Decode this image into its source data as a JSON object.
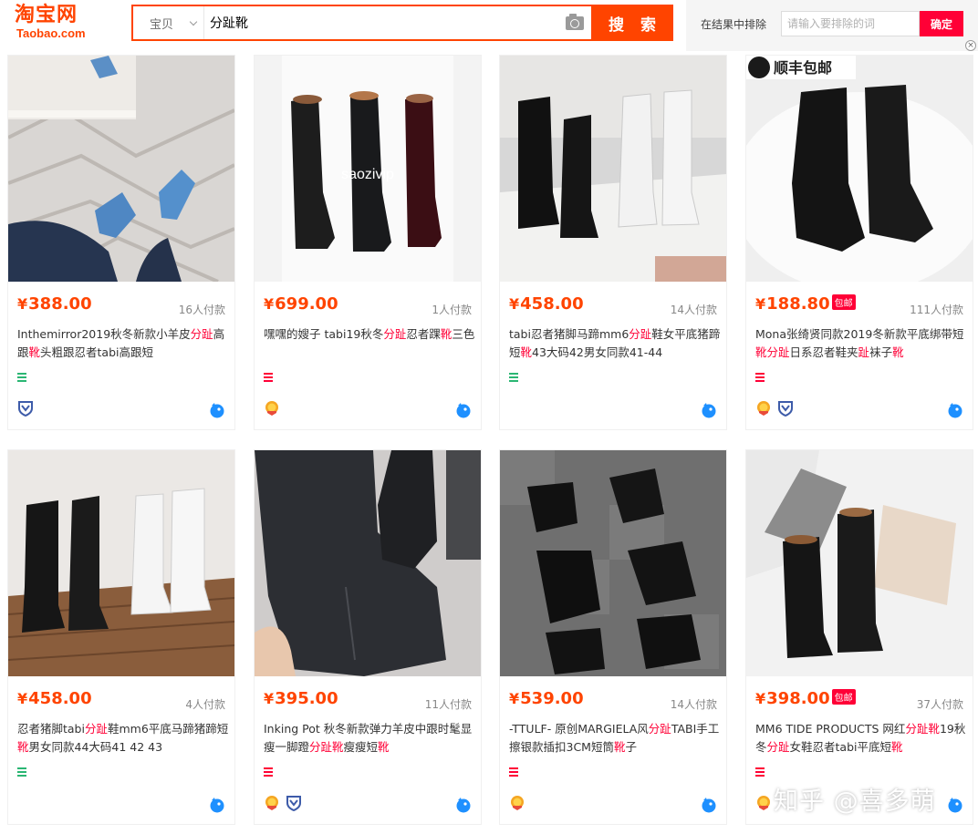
{
  "logo": {
    "cn": "淘宝网",
    "en": "Taobao.com"
  },
  "search": {
    "category": "宝贝",
    "query": "分趾靴",
    "button": "搜 索"
  },
  "exclude": {
    "label": "在结果中排除",
    "placeholder": "请输入要排除的词",
    "button": "确定",
    "close": "×"
  },
  "colors": {
    "brand": "#ff4400",
    "highlight": "#ff0036"
  },
  "items": [
    {
      "price": "388.00",
      "baoyou": "",
      "sales": "16人付款",
      "title": [
        {
          "t": "Inthemirror2019秋冬新款小羊皮"
        },
        {
          "t": "分趾",
          "hl": true
        },
        {
          "t": "高跟"
        },
        {
          "t": "靴",
          "hl": true
        },
        {
          "t": "头粗跟忍者tabi高跟短"
        }
      ],
      "menu_color": "#2bb673",
      "badges": [
        "shield"
      ]
    },
    {
      "price": "699.00",
      "baoyou": "",
      "sales": "1人付款",
      "title": [
        {
          "t": "嘿嘿的嫂子 tabi19秋冬"
        },
        {
          "t": "分趾",
          "hl": true
        },
        {
          "t": "忍者踝"
        },
        {
          "t": "靴",
          "hl": true
        },
        {
          "t": "三色"
        }
      ],
      "menu_color": "#ff0036",
      "badges": [
        "gold"
      ],
      "photo_text": "saozivip"
    },
    {
      "price": "458.00",
      "baoyou": "",
      "sales": "14人付款",
      "title": [
        {
          "t": "tabi忍者猪脚马蹄mm6"
        },
        {
          "t": "分趾",
          "hl": true
        },
        {
          "t": "鞋女平底猪蹄短"
        },
        {
          "t": "靴",
          "hl": true
        },
        {
          "t": "43大码42男女同款41-44"
        }
      ],
      "menu_color": "#2bb673",
      "badges": []
    },
    {
      "price": "188.80",
      "baoyou": "包邮",
      "sales": "111人付款",
      "title": [
        {
          "t": "Mona张绮贤同款2019冬新款平底绑带短"
        },
        {
          "t": "靴",
          "hl": true
        },
        {
          "t": "分趾",
          "hl": true
        },
        {
          "t": "日系忍者鞋夹"
        },
        {
          "t": "趾",
          "hl": true
        },
        {
          "t": "袜子"
        },
        {
          "t": "靴",
          "hl": true
        }
      ],
      "menu_color": "#ff0036",
      "badges": [
        "gold",
        "shield"
      ],
      "photo_text": "顺丰包邮"
    },
    {
      "price": "458.00",
      "baoyou": "",
      "sales": "4人付款",
      "title": [
        {
          "t": "忍者猪脚tabi"
        },
        {
          "t": "分趾",
          "hl": true
        },
        {
          "t": "鞋mm6平底马蹄猪蹄短"
        },
        {
          "t": "靴",
          "hl": true
        },
        {
          "t": "男女同款44大码41 42 43"
        }
      ],
      "menu_color": "#2bb673",
      "badges": []
    },
    {
      "price": "395.00",
      "baoyou": "",
      "sales": "11人付款",
      "title": [
        {
          "t": "Inking Pot 秋冬新款弹力羊皮中跟时髦显瘦一脚蹬"
        },
        {
          "t": "分趾靴",
          "hl": true
        },
        {
          "t": "瘦瘦短"
        },
        {
          "t": "靴",
          "hl": true
        }
      ],
      "menu_color": "#ff0036",
      "badges": [
        "gold",
        "shield"
      ]
    },
    {
      "price": "539.00",
      "baoyou": "",
      "sales": "14人付款",
      "title": [
        {
          "t": "-TTULF- 原创MARGIELA风"
        },
        {
          "t": "分趾",
          "hl": true
        },
        {
          "t": "TABI手工擦银款插扣3CM短筒"
        },
        {
          "t": "靴",
          "hl": true
        },
        {
          "t": "子"
        }
      ],
      "menu_color": "#ff0036",
      "badges": [
        "gold"
      ]
    },
    {
      "price": "398.00",
      "baoyou": "包邮",
      "sales": "37人付款",
      "title": [
        {
          "t": "MM6 TIDE PRODUCTS 网红"
        },
        {
          "t": "分趾靴",
          "hl": true
        },
        {
          "t": "19秋冬"
        },
        {
          "t": "分趾",
          "hl": true
        },
        {
          "t": "女鞋忍者tabi平底短"
        },
        {
          "t": "靴",
          "hl": true
        }
      ],
      "menu_color": "#ff0036",
      "badges": [
        "gold"
      ]
    }
  ],
  "watermark": "知乎 @喜多萌"
}
